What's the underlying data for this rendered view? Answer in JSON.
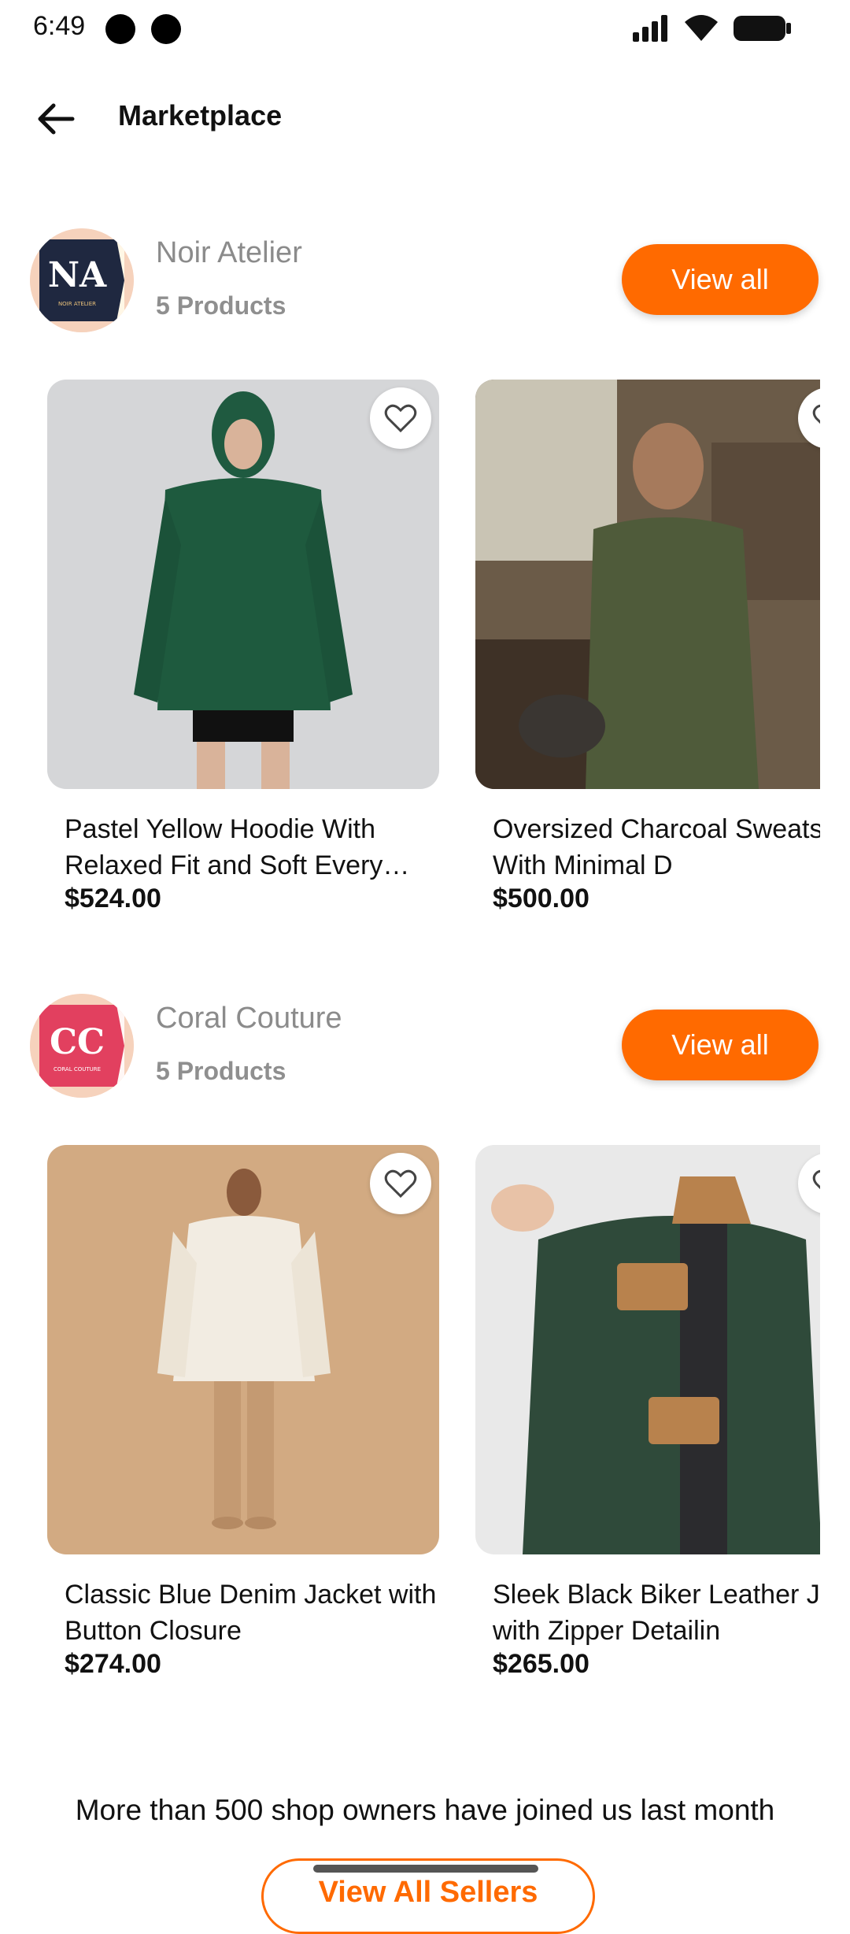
{
  "status_bar": {
    "time": "6:49"
  },
  "header": {
    "title": "Marketplace"
  },
  "shops": [
    {
      "name": "Noir Atelier",
      "product_count": "5 Products",
      "view_all_label": "View all",
      "logo_text": "NA",
      "logo_subtext": "NOIR ATELIER",
      "products": [
        {
          "name": "Pastel Yellow Hoodie With Relaxed Fit and Soft Every…",
          "price": "$524.00"
        },
        {
          "name": "Oversized Charcoal Sweatshirt With Minimal D",
          "price": "$500.00"
        }
      ]
    },
    {
      "name": "Coral Couture",
      "product_count": "5 Products",
      "view_all_label": "View all",
      "logo_text": "CC",
      "logo_subtext": "CORAL COUTURE",
      "products": [
        {
          "name": "Classic Blue Denim Jacket with Button Closure",
          "price": "$274.00"
        },
        {
          "name": "Sleek Black Biker Leather Jacket with Zipper Detailin",
          "price": "$265.00"
        }
      ]
    }
  ],
  "footer": {
    "text": "More than 500 shop owners have joined us last month",
    "button_label": "View All Sellers"
  },
  "colors": {
    "accent": "#ff6a00"
  }
}
